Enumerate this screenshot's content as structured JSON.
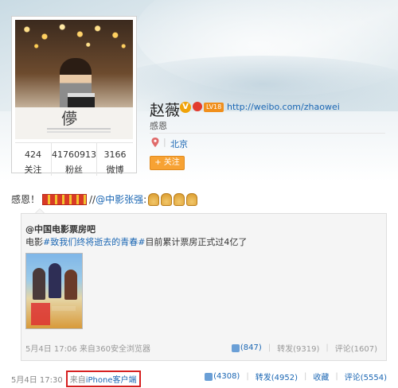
{
  "profile": {
    "name": "赵薇",
    "verified_badge": "V",
    "level_badge": "LV18",
    "homepage_url": "http://weibo.com/zhaowei",
    "bio": "感恩",
    "location": "北京",
    "follow_button": "+ 关注",
    "avatar_caption": "儚",
    "stats": [
      {
        "value": "424",
        "label": "关注"
      },
      {
        "value": "41760913",
        "label": "粉丝"
      },
      {
        "value": "3166",
        "label": "微博"
      }
    ]
  },
  "post": {
    "text_prefix": "感恩！",
    "text_sep": "//",
    "mention": "@中影张强",
    "mention_suffix": ":",
    "emoji_count": 4,
    "meta": {
      "time": "5月4日 17:30",
      "source_prefix": "来自",
      "source": "iPhone客户端"
    },
    "actions": {
      "like": "(4308)",
      "repost": "转发(4952)",
      "favorite": "收藏",
      "comment": "评论(5554)"
    }
  },
  "repost": {
    "author": "@中国电影票房吧",
    "text_before": "电影",
    "hashtag": "#致我们终将逝去的青春#",
    "text_after": "目前累计票房正式过4亿了",
    "meta": {
      "time": "5月4日 17:06",
      "source_prefix": "来自",
      "source": "360安全浏览器"
    },
    "actions": {
      "like": "(847)",
      "repost": "转发(9319)",
      "comment": "评论(1607)"
    }
  },
  "icons": {
    "location": "location-pin-icon",
    "like": "thumbs-up-icon"
  },
  "colors": {
    "link": "#1a66b3",
    "follow": "#f7a233",
    "highlight_box": "#d62020"
  }
}
